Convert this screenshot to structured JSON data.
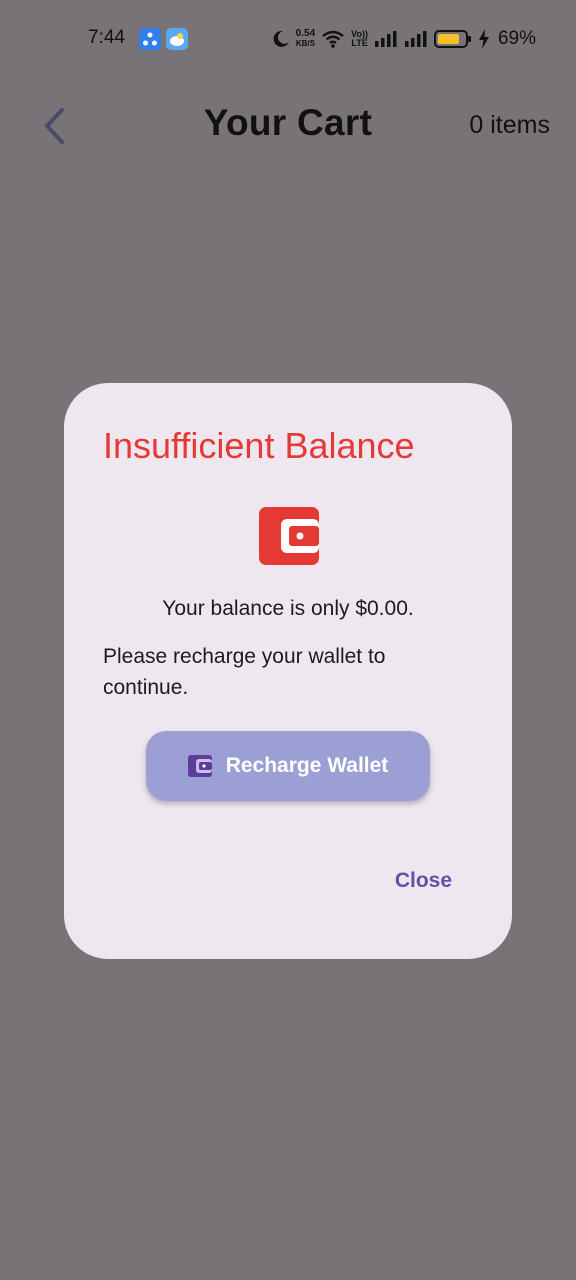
{
  "status_bar": {
    "time": "7:44",
    "net_speed_value": "0.54",
    "net_speed_unit": "KB/S",
    "volte_top": "Vo))",
    "volte_bottom": "LTE",
    "battery_percent": "69%",
    "icons": [
      "app1-icon",
      "app2-icon",
      "moon-icon",
      "wifi-icon",
      "signal-icon",
      "signal-icon",
      "battery-icon",
      "charging-icon"
    ]
  },
  "header": {
    "title": "Your Cart",
    "item_count": "0 items",
    "back_icon": "chevron-left-icon"
  },
  "dialog": {
    "title": "Insufficient Balance",
    "title_color": "#e53935",
    "icon": "wallet-icon",
    "balance_text": "Your balance is only $0.00.",
    "message": "Please recharge your wallet to continue.",
    "recharge_button": {
      "label": "Recharge Wallet",
      "icon": "wallet-icon",
      "color": "#9c9fd4"
    },
    "close_label": "Close",
    "close_color": "#6750a4"
  },
  "colors": {
    "scrim": "#777377",
    "dialog_bg": "#efe7f0"
  }
}
